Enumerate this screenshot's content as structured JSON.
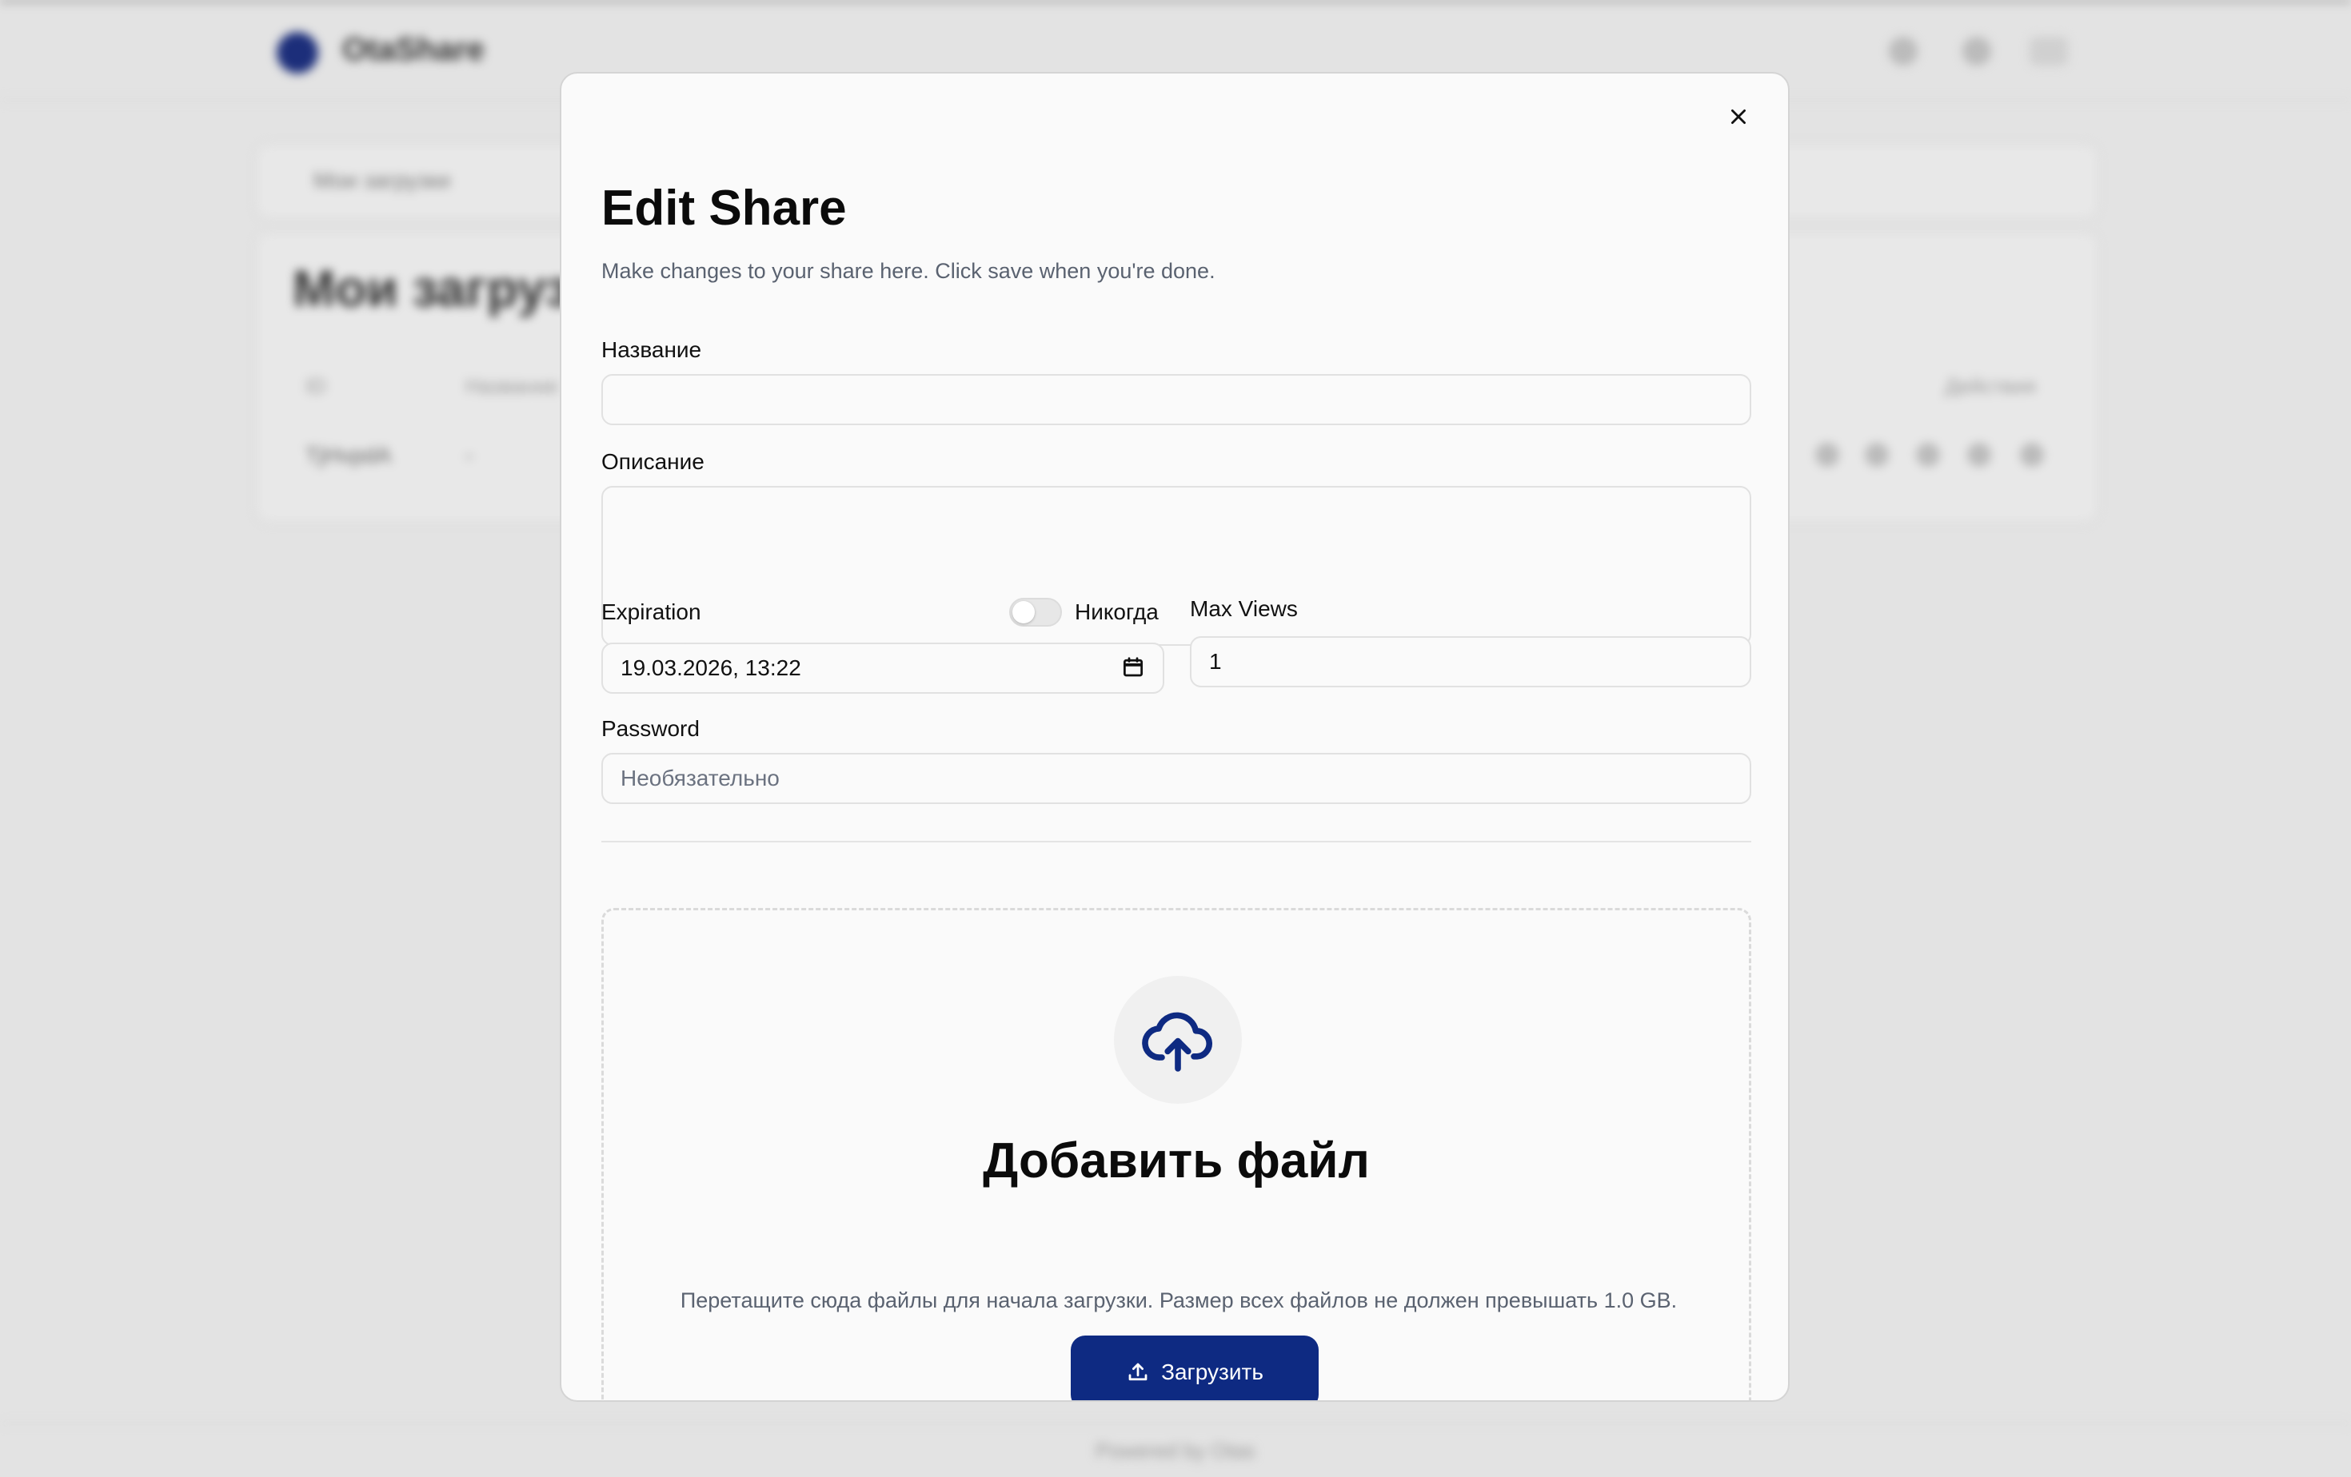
{
  "background": {
    "app_name": "OtaShare",
    "tab_label": "Мои загрузки",
    "page_title": "Мои загрузки",
    "columns": [
      "ID",
      "Название",
      "Действия"
    ],
    "row": {
      "id": "TjHvpdA",
      "name": "-"
    },
    "footer": "Powered by Otas"
  },
  "modal": {
    "title": "Edit Share",
    "subtitle": "Make changes to your share here. Click save when you're done.",
    "name_label": "Название",
    "name_value": "",
    "description_label": "Описание",
    "description_value": "",
    "expiration_label": "Expiration",
    "never_label": "Никогда",
    "never_enabled": false,
    "expiration_value": "19.03.2026, 13:22",
    "max_views_label": "Max Views",
    "max_views_value": "1",
    "password_label": "Password",
    "password_placeholder": "Необязательно",
    "dropzone_title": "Добавить файл",
    "dropzone_text": "Перетащите сюда файлы для начала загрузки. Размер всех файлов не должен превышать 1.0 GB.",
    "upload_label": "Загрузить"
  },
  "icons": {
    "close": "close-icon",
    "calendar": "calendar-icon",
    "cloud_upload": "cloud-upload-icon",
    "upload": "upload-icon"
  },
  "colors": {
    "accent": "#0e2a82",
    "muted_text": "#5a6270",
    "backdrop": "#e3e3e3"
  }
}
